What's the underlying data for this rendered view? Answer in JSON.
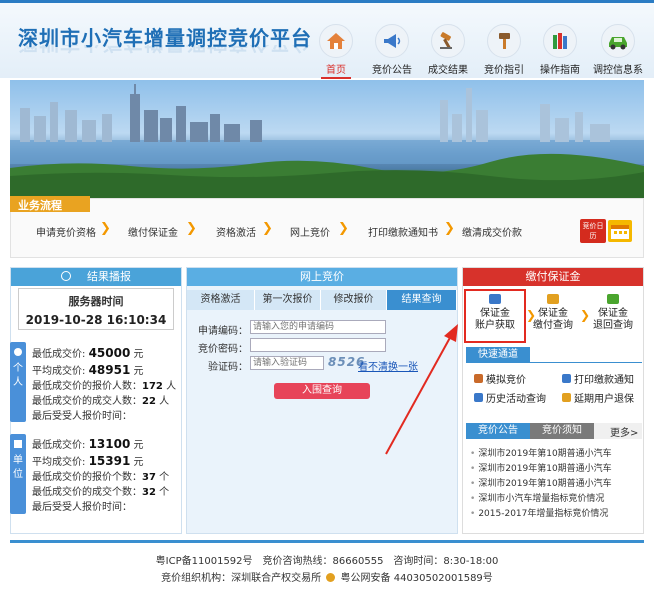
{
  "header": {
    "logo": "深圳市小汽车增量调控竞价平台",
    "nav": [
      {
        "label": "首页",
        "icon": "home-icon",
        "color": "#e4813b"
      },
      {
        "label": "竞价公告",
        "icon": "megaphone-icon",
        "color": "#3a78c9"
      },
      {
        "label": "成交结果",
        "icon": "gavel-icon",
        "color": "#c97a2a"
      },
      {
        "label": "竞价指引",
        "icon": "hammer-icon",
        "color": "#8a5a2c"
      },
      {
        "label": "操作指南",
        "icon": "books-icon",
        "color": "#2f9a3e"
      },
      {
        "label": "调控信息系",
        "icon": "car-icon",
        "color": "#4aa52e"
      }
    ]
  },
  "flow": {
    "title": "业务流程",
    "steps": [
      "申请竞价资格",
      "缴付保证金",
      "资格激活",
      "网上竞价",
      "打印缴款通知书",
      "缴清成交价款"
    ],
    "badge": "竞价日历"
  },
  "left_panel": {
    "title": "结果播报",
    "server_label": "服务器时间",
    "server_time": "2019-10-28 16:10:34",
    "personal_tag": "个人",
    "unit_tag": "单位",
    "personal": {
      "min_label": "最低成交价:",
      "min_value": "45000",
      "min_unit": "元",
      "avg_label": "平均成交价:",
      "avg_value": "48951",
      "avg_unit": "元",
      "count_label": "最低成交价的报价人数：",
      "count_value": "172",
      "count_unit": "人",
      "deal_label": "最低成交价的成交人数：",
      "deal_value": "22",
      "deal_unit": "人",
      "last_label": "最后受受人报价时间："
    },
    "unit": {
      "min_label": "最低成交价:",
      "min_value": "13100",
      "min_unit": "元",
      "avg_label": "平均成交价:",
      "avg_value": "15391",
      "avg_unit": "元",
      "count_label": "最低成交价的报价个数：",
      "count_value": "37",
      "count_unit": "个",
      "deal_label": "最低成交价的成交个数：",
      "deal_value": "32",
      "deal_unit": "个",
      "last_label": "最后受受人报价时间："
    }
  },
  "mid_panel": {
    "title": "网上竞价",
    "tabs": [
      "资格激活",
      "第一次报价",
      "修改报价",
      "结果查询"
    ],
    "code_label": "申请编码：",
    "code_placeholder": "请输入您的申请编码",
    "pwd_label": "竞价密码：",
    "captcha_label": "验证码：",
    "captcha_placeholder": "请输入验证码",
    "captcha_text": "8526",
    "captcha_link": "看不清换一张",
    "submit": "入围查询"
  },
  "right_panel": {
    "title": "缴付保证金",
    "services": [
      {
        "line1": "保证金",
        "line2": "账户获取",
        "icon": "search-doc-icon",
        "color": "#3a78c9"
      },
      {
        "line1": "保证金",
        "line2": "缴付查询",
        "icon": "wallet-icon",
        "color": "#e2a020"
      },
      {
        "line1": "保证金",
        "line2": "退回查询",
        "icon": "refund-icon",
        "color": "#4aa52e"
      }
    ],
    "quick_title": "快速通道",
    "quick": [
      {
        "label": "模拟竞价",
        "icon": "gavel-icon",
        "color": "#c96a2a"
      },
      {
        "label": "打印缴款通知",
        "icon": "print-icon",
        "color": "#3a78c9"
      },
      {
        "label": "历史活动查询",
        "icon": "history-icon",
        "color": "#3a78c9"
      },
      {
        "label": "延期用户退保",
        "icon": "doc-icon",
        "color": "#e2a020"
      }
    ],
    "news_tabs": [
      "竞价公告",
      "竞价须知"
    ],
    "news_more": "更多>",
    "news": [
      "深圳市2019年第10期普通小汽车",
      "深圳市2019年第10期普通小汽车",
      "深圳市2019年第10期普通小汽车",
      "深圳市小汽车增量指标竞价情况",
      "2015-2017年增量指标竞价情况"
    ]
  },
  "footer": {
    "line1": "粤ICP备11001592号　竞价咨询热线：86660555　咨询时间：8:30-18:00",
    "org_label": "竞价组织机构：深圳联合产权交易所",
    "police": "粤公网安备 44030502001589号"
  }
}
